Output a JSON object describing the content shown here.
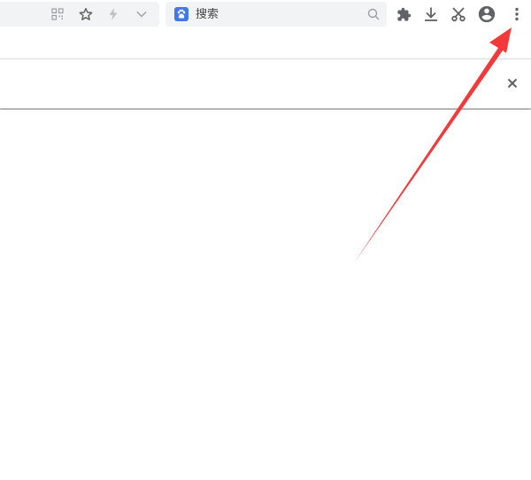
{
  "search": {
    "placeholder": "搜索",
    "engine_logo_icon": "baidu-paw-icon"
  },
  "toolbar": {
    "icons": [
      "qr-code-icon",
      "star-icon",
      "lightning-icon",
      "chevron-down-icon",
      "extensions-puzzle-icon",
      "download-icon",
      "scissors-icon",
      "account-circle-icon",
      "more-vert-icon"
    ]
  },
  "info_bar": {
    "close_icon": "close-icon"
  },
  "annotation": {
    "color": "#f23a3a",
    "icon": "red-arrow"
  },
  "colors": {
    "toolbar_icon": "#5f6368",
    "search_bg": "#f1f3f4",
    "engine_logo": "#3f78e8"
  }
}
